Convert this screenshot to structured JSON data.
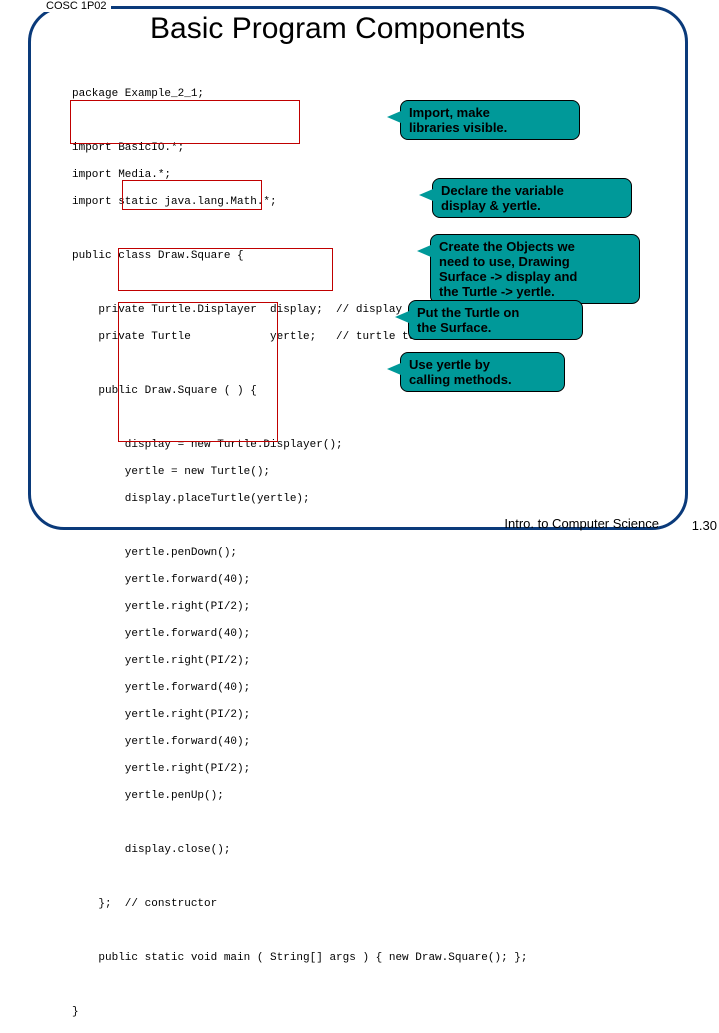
{
  "header": "COSC 1P02",
  "title": "Basic Program Components",
  "code": {
    "package": "package Example_2_1;",
    "imports": [
      "import BasicIO.*;",
      "import Media.*;",
      "import static java.lang.Math.*;"
    ],
    "class_decl": "public class Draw.Square {",
    "fields": [
      "    private Turtle.Displayer  display;  // display",
      "    private Turtle            yertle;   // turtle to"
    ],
    "ctor_decl": "    public Draw.Square ( ) {",
    "create": [
      "        display = new Turtle.Displayer();",
      "        yertle = new Turtle();",
      "        display.placeTurtle(yertle);"
    ],
    "calls": [
      "        yertle.penDown();",
      "        yertle.forward(40);",
      "        yertle.right(PI/2);",
      "        yertle.forward(40);",
      "        yertle.right(PI/2);",
      "        yertle.forward(40);",
      "        yertle.right(PI/2);",
      "        yertle.forward(40);",
      "        yertle.right(PI/2);",
      "        yertle.penUp();"
    ],
    "close": "        display.close();",
    "ctor_end": "    };  // constructor",
    "main": "    public static void main ( String[] args ) { new Draw.Square(); };",
    "class_end": "}"
  },
  "callouts": {
    "import": "Import, make\nlibraries visible.",
    "declare": "Declare the variable\ndisplay & yertle.",
    "create": "Create the Objects we\nneed to use, Drawing\nSurface -> display and\nthe Turtle -> yertle.",
    "put": "Put the Turtle on\nthe Surface.",
    "use": "Use yertle by\ncalling methods."
  },
  "footer": "Intro. to Computer Science",
  "page": "1.30"
}
